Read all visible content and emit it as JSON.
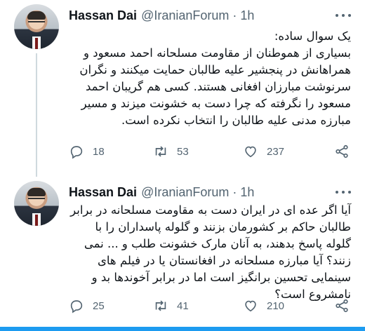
{
  "tweets": [
    {
      "author_name": "Hassan Dai",
      "handle": "@IranianForum",
      "separator": "·",
      "time": "1h",
      "text": "یک سوال ساده:\nبسیاری از هموطنان از مقاومت مسلحانه احمد مسعود و همراهانش در پنجشیر علیه طالبان حمایت میکنند و نگران سرنوشت مبارزان افغانی هستند. کسی هم گریبان احمد مسعود را نگرفته که چرا دست به خشونت میزند و مسیر مبارزه مدنی علیه طالبان را انتخاب نکرده است.",
      "replies": "18",
      "retweets": "53",
      "likes": "237"
    },
    {
      "author_name": "Hassan Dai",
      "handle": "@IranianForum",
      "separator": "·",
      "time": "1h",
      "text": "آیا اگر عده ای در ایران دست به مقاومت مسلحانه در برابر طالبان حاکم بر کشورمان بزنند و گلوله پاسداران را با گلوله پاسخ بدهند، به آنان مارک خشونت طلب و ... نمی زنند؟ آیا مبارزه مسلحانه در افغانستان یا در فیلم های سینمایی تحسین برانگیز است اما در برابر آخوندها بد و نامشروع است؟",
      "replies": "25",
      "retweets": "41",
      "likes": "210"
    }
  ],
  "icons": {
    "reply": "reply-icon",
    "retweet": "retweet-icon",
    "like": "heart-icon",
    "share": "share-icon",
    "more": "more-icon"
  },
  "colors": {
    "accent": "#1d9bf0",
    "muted": "#536471",
    "text": "#0f1419",
    "thread_line": "#cfd9de"
  }
}
